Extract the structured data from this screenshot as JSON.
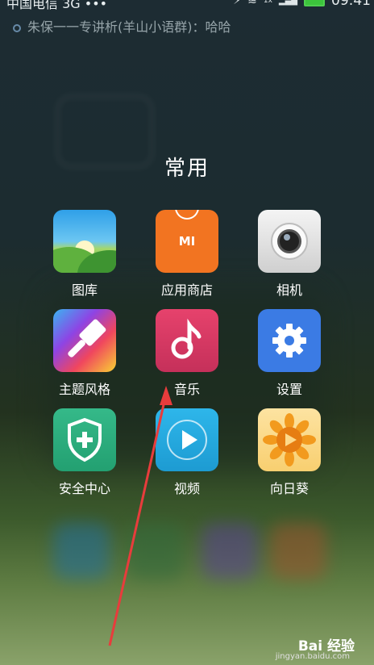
{
  "status_bar": {
    "carrier": "中国电信 3G •••",
    "time": "09:41",
    "signal": "1x",
    "notification": "朱保一一专讲析(羊山小语群)：哈哈"
  },
  "folder": {
    "title": "常用"
  },
  "apps": [
    {
      "label": "图库",
      "icon": "gallery-icon"
    },
    {
      "label": "应用商店",
      "icon": "mi-store-icon",
      "icon_text": "MI"
    },
    {
      "label": "相机",
      "icon": "camera-icon"
    },
    {
      "label": "主题风格",
      "icon": "theme-brush-icon"
    },
    {
      "label": "音乐",
      "icon": "music-note-icon"
    },
    {
      "label": "设置",
      "icon": "gear-icon"
    },
    {
      "label": "安全中心",
      "icon": "shield-plus-icon"
    },
    {
      "label": "视频",
      "icon": "play-icon"
    },
    {
      "label": "向日葵",
      "icon": "sunflower-icon"
    }
  ],
  "colors": {
    "arrow": "#e83c3c",
    "store": "#f27421",
    "settings": "#3b7be4",
    "security": "#23a071",
    "video": "#1d9bd2",
    "music": "#d43560"
  },
  "watermark": {
    "brand": "Bai 经验",
    "url": "jingyan.baidu.com"
  }
}
